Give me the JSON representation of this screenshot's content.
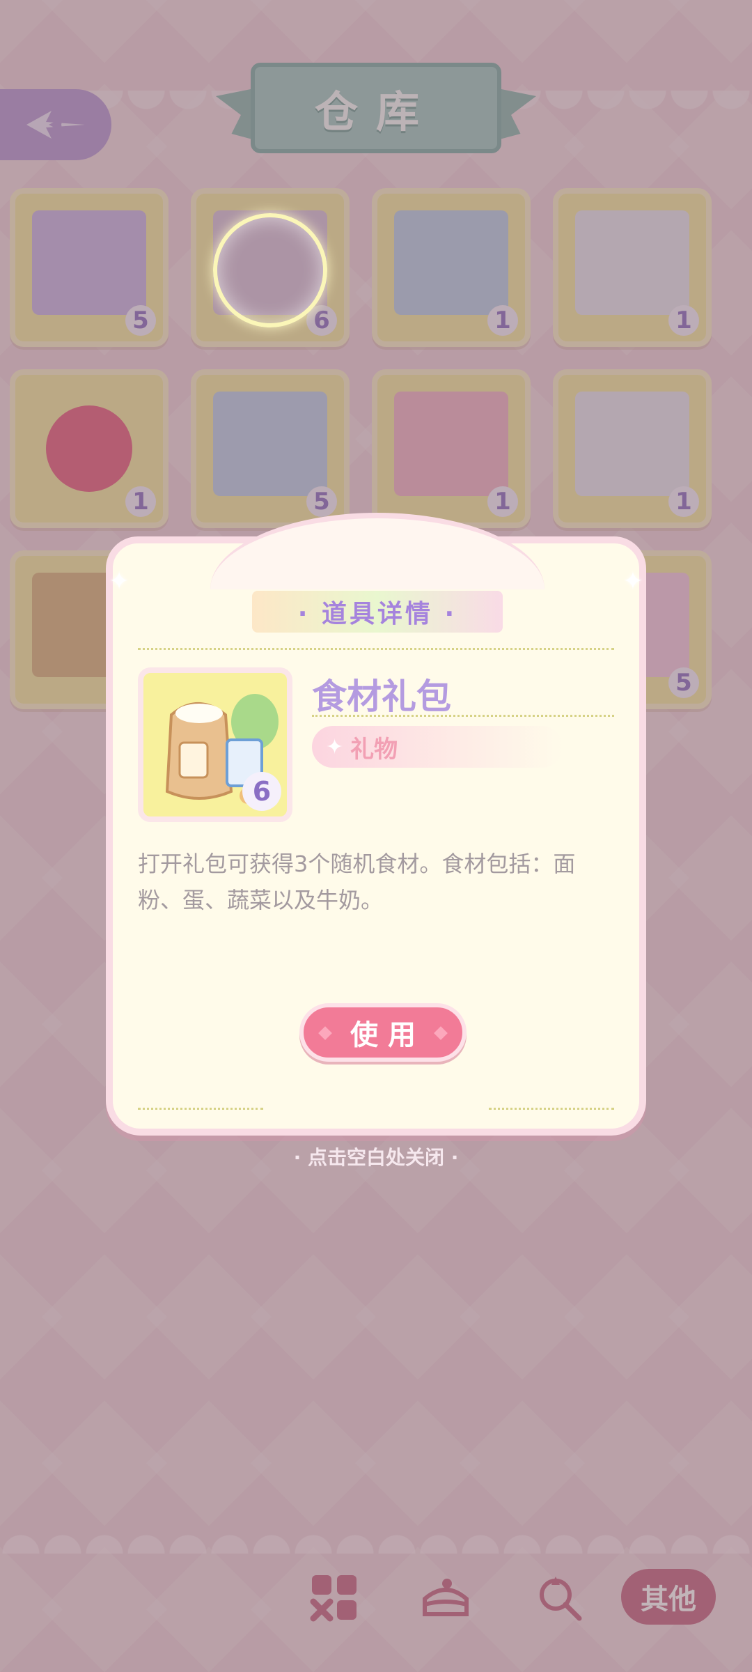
{
  "header": {
    "title": "仓库",
    "back_icon": "back-arrow-icon"
  },
  "grid": {
    "items": [
      {
        "count": "5",
        "color": "#c9b6e6"
      },
      {
        "count": "6",
        "color": "#d7c3da"
      },
      {
        "count": "1",
        "color": "#b8cfe8"
      },
      {
        "count": "1",
        "color": "#e6e6ee"
      },
      {
        "count": "1",
        "color": "#e5607f"
      },
      {
        "count": "5",
        "color": "#bcd0ea"
      },
      {
        "count": "1",
        "color": "#f1b5c7"
      },
      {
        "count": "1",
        "color": "#e6e6ee"
      },
      {
        "count": "",
        "color": "#d8b47c"
      },
      {
        "count": "",
        "color": "#e8e0b0"
      },
      {
        "count": "",
        "color": "#e8e0b0"
      },
      {
        "count": "5",
        "color": "#f2cbe0"
      }
    ]
  },
  "modal": {
    "header": "· 道具详情 ·",
    "item_name": "食材礼包",
    "item_count": "6",
    "tag": "礼物",
    "description": "打开礼包可获得3个随机食材。食材包括：面粉、蛋、蔬菜以及牛奶。",
    "use_button": "使用"
  },
  "close_hint": "· 点击空白处关闭 ·",
  "bottom_nav": {
    "items": [
      {
        "icon": "grid-icon"
      },
      {
        "icon": "cake-icon"
      },
      {
        "icon": "candy-icon"
      }
    ],
    "active_label": "其他"
  },
  "colors": {
    "accent_pink": "#f27b97",
    "accent_purple": "#b49be0",
    "ribbon_teal": "#9fcbc3"
  }
}
